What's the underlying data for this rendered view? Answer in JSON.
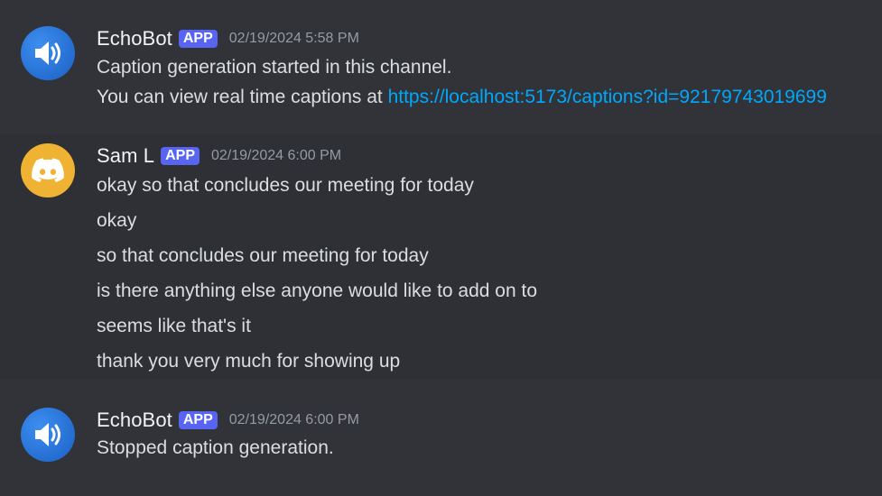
{
  "messages": [
    {
      "author": "EchoBot",
      "badge": "APP",
      "timestamp": "02/19/2024 5:58 PM",
      "avatar_icon": "speaker-icon",
      "avatar_color": "#1e6fd9",
      "lines": [
        {
          "text": "Caption generation started in this channel."
        },
        {
          "text": "You can view real time captions at ",
          "link": "https://localhost:5173/captions?id=92179743019699"
        }
      ]
    },
    {
      "author": "Sam L",
      "badge": "APP",
      "timestamp": "02/19/2024 6:00 PM",
      "avatar_icon": "discord-logo-icon",
      "avatar_color": "#f0b232",
      "lines": [
        {
          "text": "okay so that concludes our meeting for today"
        },
        {
          "text": "okay"
        },
        {
          "text": "so that concludes our meeting for today"
        },
        {
          "text": "is there anything else anyone would like to add on to"
        },
        {
          "text": "seems like that's it"
        },
        {
          "text": "thank you very much for showing up"
        }
      ]
    },
    {
      "author": "EchoBot",
      "badge": "APP",
      "timestamp": "02/19/2024 6:00 PM",
      "avatar_icon": "speaker-icon",
      "avatar_color": "#1e6fd9",
      "lines": [
        {
          "text": "Stopped caption generation."
        }
      ]
    }
  ],
  "colors": {
    "background": "#313338",
    "text": "#dbdee1",
    "username": "#f2f3f5",
    "timestamp": "#949ba4",
    "badge": "#5865f2",
    "link": "#00a8fc"
  }
}
